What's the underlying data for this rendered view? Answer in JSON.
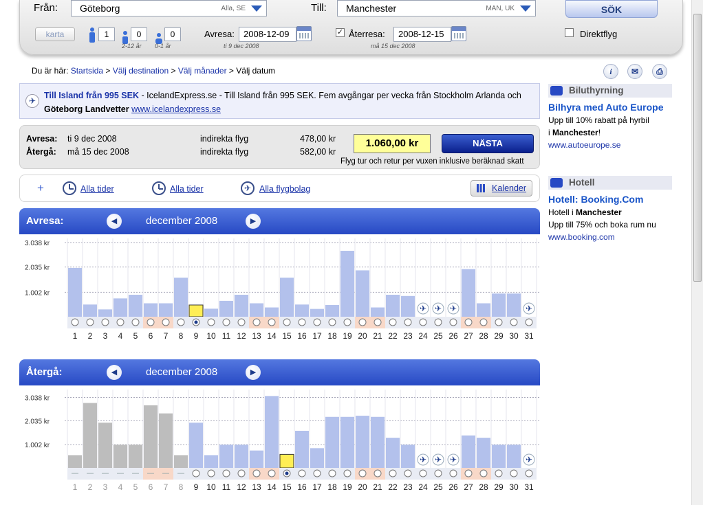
{
  "search": {
    "from_label": "Från:",
    "from_value": "Göteborg",
    "from_code": "Alla, SE",
    "to_label": "Till:",
    "to_value": "Manchester",
    "to_code": "MAN, UK",
    "search_button": "SÖK",
    "map_button": "karta",
    "adults": "1",
    "children": "0",
    "children_note": "2-12 år",
    "infants": "0",
    "infants_note": "0-1 år",
    "depart_label": "Avresa:",
    "depart_date": "2008-12-09",
    "depart_note": "ti 9 dec 2008",
    "return_label": "Återresa:",
    "return_date": "2008-12-15",
    "return_note": "må 15 dec 2008",
    "return_checked": "✓",
    "direct_label": "Direktflyg"
  },
  "breadcrumb": {
    "prefix": "Du är här:",
    "items": [
      "Startsida",
      "Välj destination",
      "Välj månader"
    ],
    "sep": ">",
    "current": "Välj datum"
  },
  "tools": {
    "info": "i",
    "mail": "✉",
    "print": "⎙"
  },
  "ad": {
    "title": "Till Island från 995 SEK",
    "text1": " - IcelandExpress.se - Till Island från 995 SEK. Fem avgångar per vecka från Stockholm Arlanda och ",
    "bold": "Göteborg Landvetter",
    "link": "www.icelandexpress.se"
  },
  "summary": {
    "out_label": "Avresa:",
    "out_date": "ti 9 dec 2008",
    "out_type": "indirekta flyg",
    "out_price": "478,00 kr",
    "ret_label": "Återgå:",
    "ret_date": "må 15 dec 2008",
    "ret_type": "indirekta flyg",
    "ret_price": "582,00 kr",
    "total": "1.060,00 kr",
    "next_button": "NÄSTA",
    "note": "Flyg tur och retur per vuxen inklusive beräknad skatt"
  },
  "filters": {
    "plus": "+",
    "times1": "Alla tider",
    "times2": "Alla tider",
    "airlines": "Alla flygbolag",
    "calendar": "Kalender"
  },
  "outbound": {
    "title": "Avresa:",
    "month": "december 2008",
    "prev": "◀",
    "next": "▶"
  },
  "inbound": {
    "title": "Återgå:",
    "month": "december 2008",
    "prev": "◀",
    "next": "▶"
  },
  "chart_data": [
    {
      "type": "bar",
      "name_ref": "outbound",
      "categories": [
        "1",
        "2",
        "3",
        "4",
        "5",
        "6",
        "7",
        "8",
        "9",
        "10",
        "11",
        "12",
        "13",
        "14",
        "15",
        "16",
        "17",
        "18",
        "19",
        "20",
        "21",
        "22",
        "23",
        "24",
        "25",
        "26",
        "27",
        "28",
        "29",
        "30",
        "31"
      ],
      "values": [
        2000,
        500,
        300,
        750,
        900,
        550,
        550,
        1600,
        480,
        330,
        650,
        900,
        550,
        380,
        1600,
        500,
        320,
        480,
        2700,
        1900,
        380,
        900,
        850,
        null,
        null,
        null,
        1950,
        550,
        950,
        950,
        null
      ],
      "selected": 9,
      "weekend_days": [
        6,
        7,
        13,
        14,
        20,
        21,
        27,
        28
      ],
      "no_flight_days": [
        24,
        25,
        26,
        31
      ],
      "yticks": [
        "3.038 kr",
        "2.035 kr",
        "1.002 kr"
      ],
      "ytick_values": [
        3038,
        2035,
        1002
      ],
      "ylim": [
        0,
        3038
      ]
    },
    {
      "type": "bar",
      "name_ref": "inbound",
      "categories": [
        "1",
        "2",
        "3",
        "4",
        "5",
        "6",
        "7",
        "8",
        "9",
        "10",
        "11",
        "12",
        "13",
        "14",
        "15",
        "16",
        "17",
        "18",
        "19",
        "20",
        "21",
        "22",
        "23",
        "24",
        "25",
        "26",
        "27",
        "28",
        "29",
        "30",
        "31"
      ],
      "values": [
        550,
        2800,
        1950,
        1000,
        1000,
        2700,
        2350,
        550,
        1950,
        550,
        1000,
        1000,
        750,
        3100,
        582,
        1600,
        850,
        2200,
        2200,
        2250,
        2200,
        1300,
        1000,
        null,
        null,
        null,
        1400,
        1300,
        1000,
        1000,
        null
      ],
      "selected": 15,
      "unavailable_days": [
        1,
        2,
        3,
        4,
        5,
        6,
        7,
        8
      ],
      "weekend_days": [
        6,
        7,
        13,
        14,
        20,
        21,
        27,
        28
      ],
      "no_flight_days": [
        24,
        25,
        26,
        31
      ],
      "yticks": [
        "3.038 kr",
        "2.035 kr",
        "1.002 kr"
      ],
      "ytick_values": [
        3038,
        2035,
        1002
      ],
      "ylim": [
        0,
        3200
      ]
    }
  ],
  "sidebar": {
    "car_head": "Biluthyrning",
    "car_title": "Bilhyra med Auto Europe",
    "car_line1": "Upp till 10% rabatt på hyrbil",
    "car_line2a": "i ",
    "car_line2b": "Manchester",
    "car_line2c": "!",
    "car_link": "www.autoeurope.se",
    "hotel_head": "Hotell",
    "hotel_title": "Hotell: Booking.Com",
    "hotel_line1a": "Hotell i ",
    "hotel_line1b": "Manchester",
    "hotel_line2": "Upp till 75% och boka rum nu",
    "hotel_link": "www.booking.com"
  },
  "colors": {
    "bar": "#b3c1ec",
    "bar_unavailable": "#bdbdbd",
    "bar_selected": "#ffee55",
    "weekend": "#f8d8c8",
    "header": "#2f55cc"
  }
}
